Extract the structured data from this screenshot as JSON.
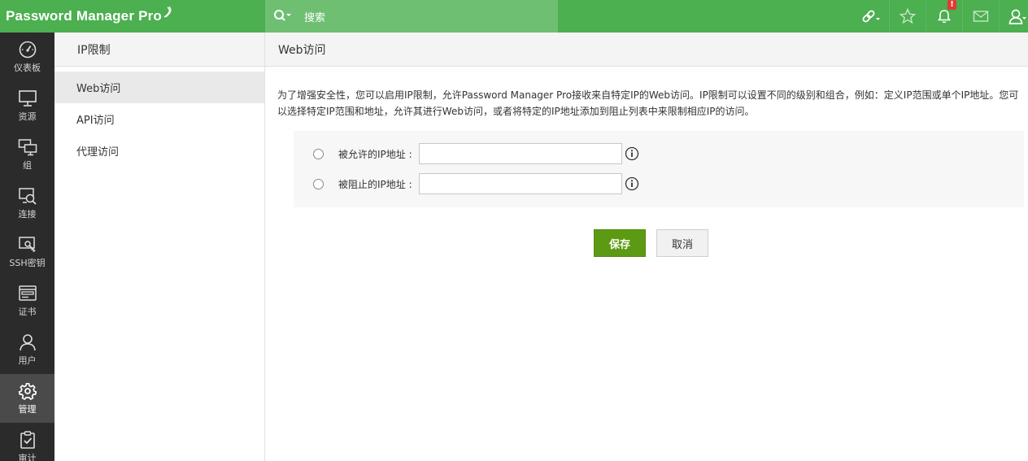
{
  "app": {
    "logo_text": "Password Manager Pro"
  },
  "search": {
    "label": "搜索"
  },
  "top_icons": [
    "link-icon",
    "star-icon",
    "bell-icon",
    "mail-icon",
    "user-icon"
  ],
  "notification_badge": "!",
  "leftnav": {
    "items": [
      {
        "label": "仪表板",
        "icon": "dashboard-icon"
      },
      {
        "label": "资源",
        "icon": "monitor-icon"
      },
      {
        "label": "组",
        "icon": "groups-icon"
      },
      {
        "label": "连接",
        "icon": "connection-icon"
      },
      {
        "label": "SSH密钥",
        "icon": "ssh-key-icon"
      },
      {
        "label": "证书",
        "icon": "certificate-icon"
      },
      {
        "label": "用户",
        "icon": "user-icon"
      },
      {
        "label": "管理",
        "icon": "gear-icon",
        "active": true
      },
      {
        "label": "审计",
        "icon": "audit-icon"
      }
    ]
  },
  "subnav": {
    "title": "IP限制",
    "items": [
      {
        "label": "Web访问",
        "active": true
      },
      {
        "label": "API访问"
      },
      {
        "label": "代理访问"
      }
    ]
  },
  "main": {
    "title": "Web访问",
    "description": "为了增强安全性，您可以启用IP限制，允许Password Manager Pro接收来自特定IP的Web访问。IP限制可以设置不同的级别和组合，例如：定义IP范围或单个IP地址。您可以选择特定IP范围和地址，允许其进行Web访问，或者将特定的IP地址添加到阻止列表中来限制相应IP的访问。",
    "allowed_label": "被允许的IP地址 :",
    "allowed_value": "",
    "blocked_label": "被阻止的IP地址 :",
    "blocked_value": "",
    "save_label": "保存",
    "cancel_label": "取消"
  },
  "colors": {
    "topbar": "#4caf50",
    "search": "#6fbf73",
    "leftnav": "#2b2b2b",
    "save": "#5b9a12"
  }
}
